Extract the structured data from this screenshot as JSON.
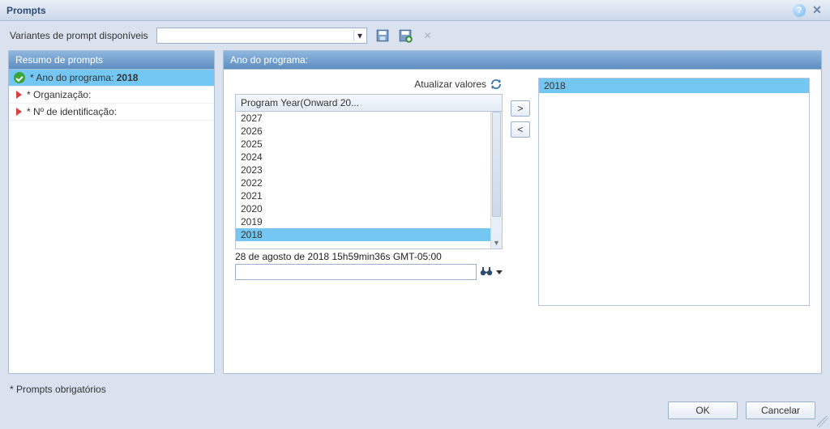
{
  "window": {
    "title": "Prompts"
  },
  "toolbar": {
    "variants_label": "Variantes de prompt disponíveis",
    "combo_value": ""
  },
  "left": {
    "header": "Resumo de prompts",
    "items": [
      {
        "status": "ok",
        "label": "* Ano do programa: ",
        "bold": "2018"
      },
      {
        "status": "pending",
        "label": "* Organização:",
        "bold": ""
      },
      {
        "status": "pending",
        "label": "* Nº de identificação:",
        "bold": ""
      }
    ]
  },
  "right": {
    "header": "Ano do programa:",
    "refresh_label": "Atualizar valores",
    "grid_header": "Program Year(Onward 20...",
    "options": [
      "2027",
      "2026",
      "2025",
      "2024",
      "2023",
      "2022",
      "2021",
      "2020",
      "2019",
      "2018"
    ],
    "selected_option": "2018",
    "timestamp": "28 de agosto de 2018 15h59min36s GMT-05:00",
    "search_value": "",
    "chosen": [
      "2018"
    ]
  },
  "footer": {
    "note": "* Prompts obrigatórios",
    "ok": "OK",
    "cancel": "Cancelar"
  }
}
